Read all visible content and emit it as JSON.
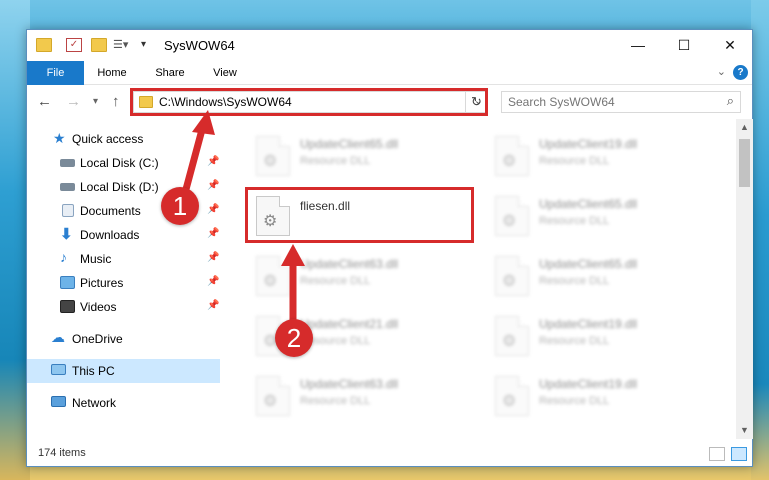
{
  "window": {
    "title": "SysWOW64",
    "controls": {
      "minimize": "—",
      "maximize": "☐",
      "close": "✕"
    }
  },
  "ribbon": {
    "tabs": [
      {
        "label": "File",
        "active": true
      },
      {
        "label": "Home"
      },
      {
        "label": "Share"
      },
      {
        "label": "View"
      }
    ],
    "help": "?"
  },
  "address_bar": {
    "path": "C:\\Windows\\SysWOW64",
    "search_placeholder": "Search SysWOW64"
  },
  "nav_pane": {
    "items": [
      {
        "label": "Quick access",
        "icon": "star-icon",
        "pinned": false
      },
      {
        "label": "Local Disk (C:)",
        "icon": "drive-icon",
        "pinned": true
      },
      {
        "label": "Local Disk (D:)",
        "icon": "drive-icon",
        "pinned": true
      },
      {
        "label": "Documents",
        "icon": "documents-icon",
        "pinned": true
      },
      {
        "label": "Downloads",
        "icon": "download-icon",
        "pinned": true
      },
      {
        "label": "Music",
        "icon": "music-icon",
        "pinned": true
      },
      {
        "label": "Pictures",
        "icon": "pictures-icon",
        "pinned": true
      },
      {
        "label": "Videos",
        "icon": "videos-icon",
        "pinned": true
      },
      {
        "label": "OneDrive",
        "icon": "cloud-icon"
      },
      {
        "label": "This PC",
        "icon": "computer-icon",
        "selected": true
      },
      {
        "label": "Network",
        "icon": "network-icon"
      }
    ]
  },
  "files": {
    "highlighted": {
      "name": "fliesen.dll"
    },
    "left_column": [
      {
        "name": "UpdateClient65.dll",
        "type": "Resource DLL"
      },
      {
        "name": "UpdateClient63.dll",
        "type": "Resource DLL"
      },
      {
        "name": "UpdateClient21.dll",
        "type": "Resource DLL"
      },
      {
        "name": "UpdateClient63.dll",
        "type": "Resource DLL"
      }
    ],
    "right_column": [
      {
        "name": "UpdateClient19.dll",
        "type": "Resource DLL"
      },
      {
        "name": "UpdateClient65.dll",
        "type": "Resource DLL"
      },
      {
        "name": "UpdateClient65.dll",
        "type": "Resource DLL"
      },
      {
        "name": "UpdateClient19.dll",
        "type": "Resource DLL"
      },
      {
        "name": "UpdateClient19.dll",
        "type": "Resource DLL"
      }
    ]
  },
  "status": {
    "item_count": "174 items"
  },
  "annotations": {
    "step1": "1",
    "step2": "2",
    "color": "#d62b2b"
  }
}
